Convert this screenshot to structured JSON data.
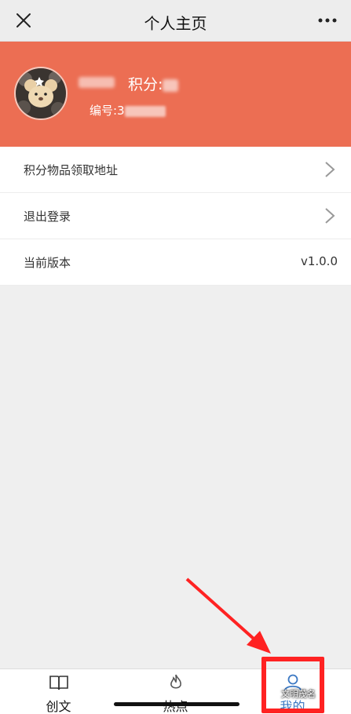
{
  "titlebar": {
    "title": "个人主页",
    "close_icon": "close-icon",
    "more_icon": "more-icon"
  },
  "profile": {
    "points_label": "积分:",
    "id_label": "编号:3"
  },
  "menu": [
    {
      "label": "积分物品领取地址",
      "has_chevron": true
    },
    {
      "label": "退出登录",
      "has_chevron": true
    },
    {
      "label": "当前版本",
      "value": "v1.0.0"
    }
  ],
  "tabs": [
    {
      "label": "创文",
      "icon": "book-icon"
    },
    {
      "label": "热点",
      "icon": "fire-icon"
    },
    {
      "label": "我的",
      "icon": "user-icon",
      "active": true
    }
  ],
  "annotation": {
    "watermark": "文明茂名",
    "highlight_color": "#ff2222"
  },
  "colors": {
    "banner": "#ec6e53",
    "active_tab": "#3b78c3"
  }
}
